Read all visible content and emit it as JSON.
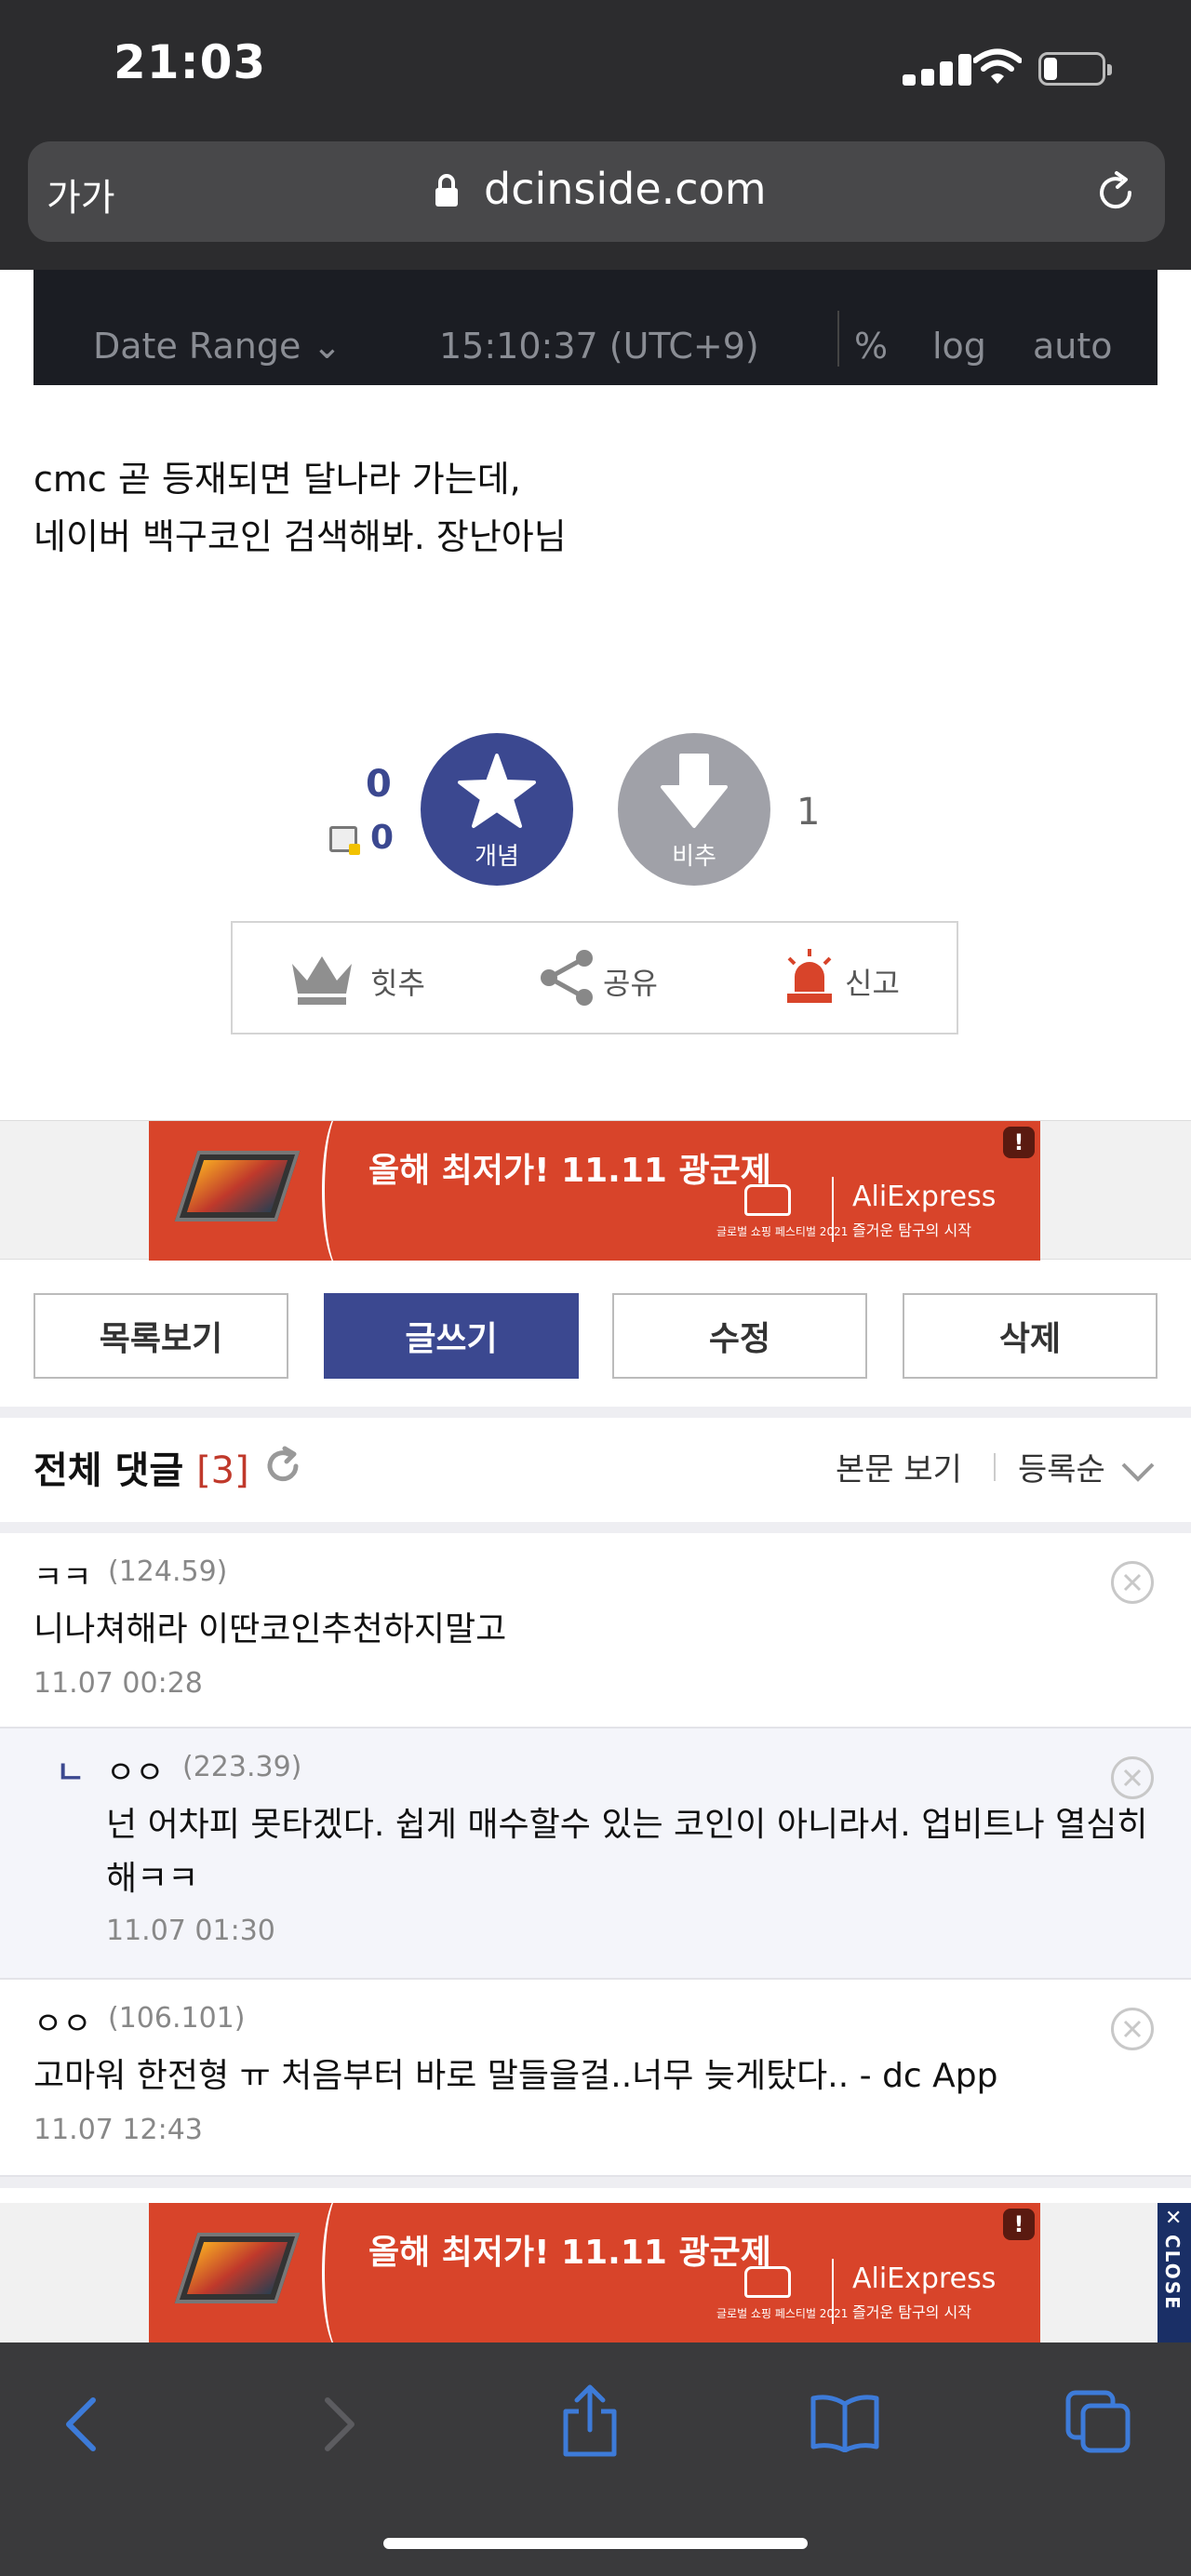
{
  "status_bar": {
    "time": "21:03"
  },
  "browser": {
    "text_size_label": "가가",
    "url": "dcinside.com"
  },
  "chart_strip": {
    "date_range": "Date Range",
    "timestamp": "15:10:37 (UTC+9)",
    "percent": "%",
    "log": "log",
    "auto": "auto"
  },
  "post": {
    "line1": "cmc 곧 등재되면 달나라 가는데,",
    "line2": "네이버 백구코인 검색해봐. 장난아님"
  },
  "vote": {
    "recommend_count": "0",
    "fixed_count": "0",
    "recommend_label": "개념",
    "downvote_label": "비추",
    "downvote_count": "1"
  },
  "actions": {
    "hit": "힛추",
    "share": "공유",
    "report": "신고"
  },
  "ad": {
    "headline": "올해 최저가! 11.11 광군제",
    "brand": "AliExpress",
    "tagline": "즐거운 탐구의 시작",
    "festival": "글로벌 쇼핑 페스티벌 2021",
    "badge": "!"
  },
  "buttons": {
    "list": "목록보기",
    "write": "글쓰기",
    "edit": "수정",
    "delete": "삭제"
  },
  "comments_header": {
    "title": "전체 댓글",
    "count": "[3]",
    "view_body": "본문 보기",
    "sort": "등록순"
  },
  "comments": [
    {
      "nick": "ㅋㅋ",
      "ip": "(124.59)",
      "text": "니나쳐해라 이딴코인추천하지말고",
      "date": "11.07 00:28"
    },
    {
      "reply_mark": "ㄴ",
      "nick": "ㅇㅇ",
      "ip": "(223.39)",
      "text1": "넌 어차피 못타겠다. 쉽게 매수할수 있는 코인이 아니라서. 업비트나 열심히",
      "text2": "해ㅋㅋ",
      "date": "11.07 01:30"
    },
    {
      "nick": "ㅇㅇ",
      "ip": "(106.101)",
      "text": "고마워 한전형 ㅠ 처음부터 바로 말들을걸..너무 늦게탔다.. - dc App",
      "date": "11.07 12:43"
    }
  ],
  "side_tab": {
    "close": "CLOSE"
  },
  "colors": {
    "accent": "#3b4890",
    "ad_red": "#d8442a",
    "ios_blue": "#3d7bd9"
  }
}
